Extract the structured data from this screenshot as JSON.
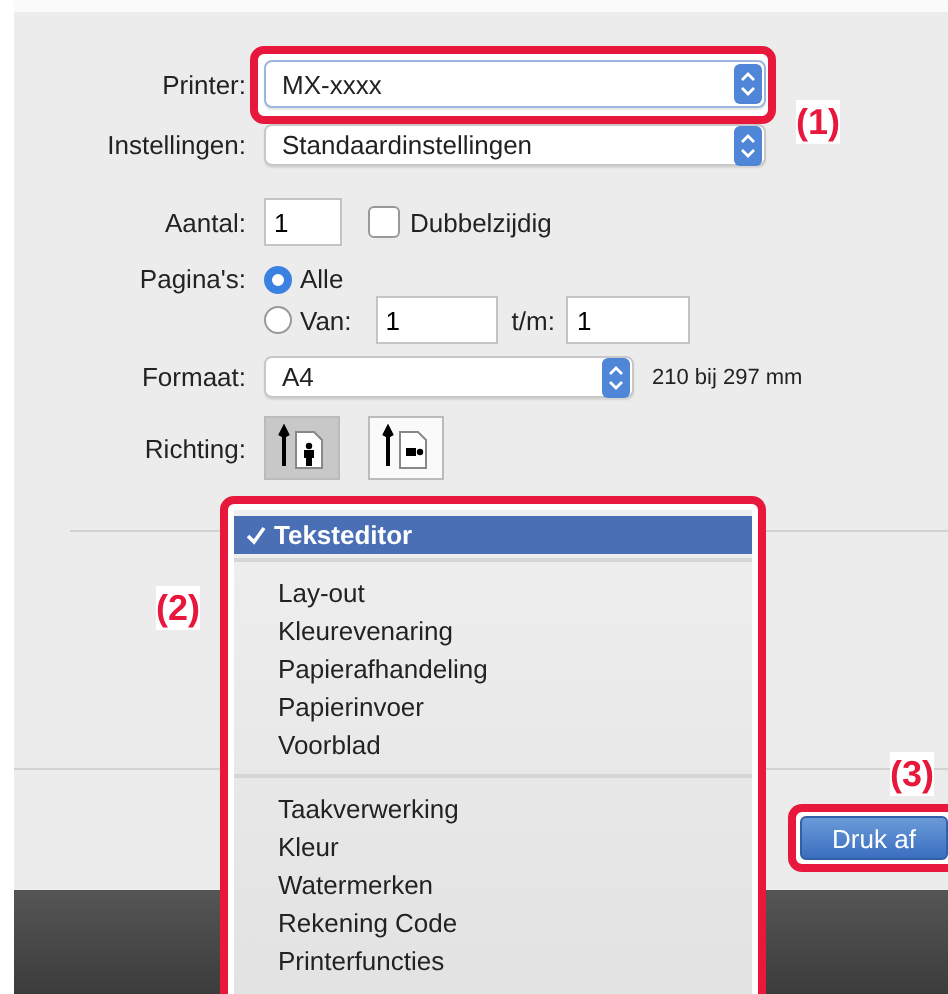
{
  "printer": {
    "label": "Printer:",
    "value": "MX-xxxx"
  },
  "settings": {
    "label": "Instellingen:",
    "value": "Standaardinstellingen"
  },
  "copies": {
    "label": "Aantal:",
    "value": "1"
  },
  "duplex": {
    "label": "Dubbelzijdig",
    "checked": false
  },
  "pages": {
    "label": "Pagina's:",
    "options": [
      {
        "label": "Alle",
        "selected": true
      },
      {
        "label": "Van:",
        "selected": false
      }
    ],
    "from": "1",
    "to_label": "t/m:",
    "to": "1"
  },
  "paper_size": {
    "label": "Formaat:",
    "value": "A4",
    "dimensions": "210 bij 297 mm"
  },
  "orientation": {
    "label": "Richting:",
    "options": [
      {
        "kind": "portrait",
        "selected": true
      },
      {
        "kind": "landscape",
        "selected": false
      }
    ]
  },
  "menu": {
    "sections": [
      {
        "items": [
          {
            "label": "Teksteditor",
            "selected": true
          }
        ]
      },
      {
        "items": [
          {
            "label": "Lay-out",
            "selected": false
          },
          {
            "label": "Kleurevenaring",
            "selected": false
          },
          {
            "label": "Papierafhandeling",
            "selected": false
          },
          {
            "label": "Papierinvoer",
            "selected": false
          },
          {
            "label": "Voorblad",
            "selected": false
          }
        ]
      },
      {
        "items": [
          {
            "label": "Taakverwerking",
            "selected": false
          },
          {
            "label": "Kleur",
            "selected": false
          },
          {
            "label": "Watermerken",
            "selected": false
          },
          {
            "label": "Rekening Code",
            "selected": false
          },
          {
            "label": "Printerfuncties",
            "selected": false
          }
        ]
      }
    ]
  },
  "print_button": "Druk af",
  "callouts": [
    "(1)",
    "(2)",
    "(3)"
  ]
}
